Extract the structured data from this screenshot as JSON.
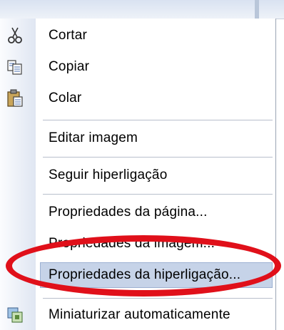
{
  "menu": {
    "items": [
      {
        "label": "Cortar",
        "icon": "scissors-icon"
      },
      {
        "label": "Copiar",
        "icon": "copy-icon"
      },
      {
        "label": "Colar",
        "icon": "paste-icon"
      },
      {
        "label": "Editar imagem",
        "icon": ""
      },
      {
        "label": "Seguir hiperligação",
        "icon": ""
      },
      {
        "label": "Propriedades da página...",
        "icon": ""
      },
      {
        "label": "Propriedades da imagem...",
        "icon": ""
      },
      {
        "label": "Propriedades da hiperligação...",
        "icon": "",
        "highlighted": true
      },
      {
        "label": "Miniaturizar automaticamente",
        "icon": "auto-thumbnail-icon"
      }
    ]
  },
  "annotation": {
    "color": "#e0101a",
    "shape": "ellipse",
    "target": "Propriedades da hiperligação..."
  },
  "colors": {
    "highlight": "#c6d3e8",
    "highlight_border": "#9cb1d2"
  }
}
